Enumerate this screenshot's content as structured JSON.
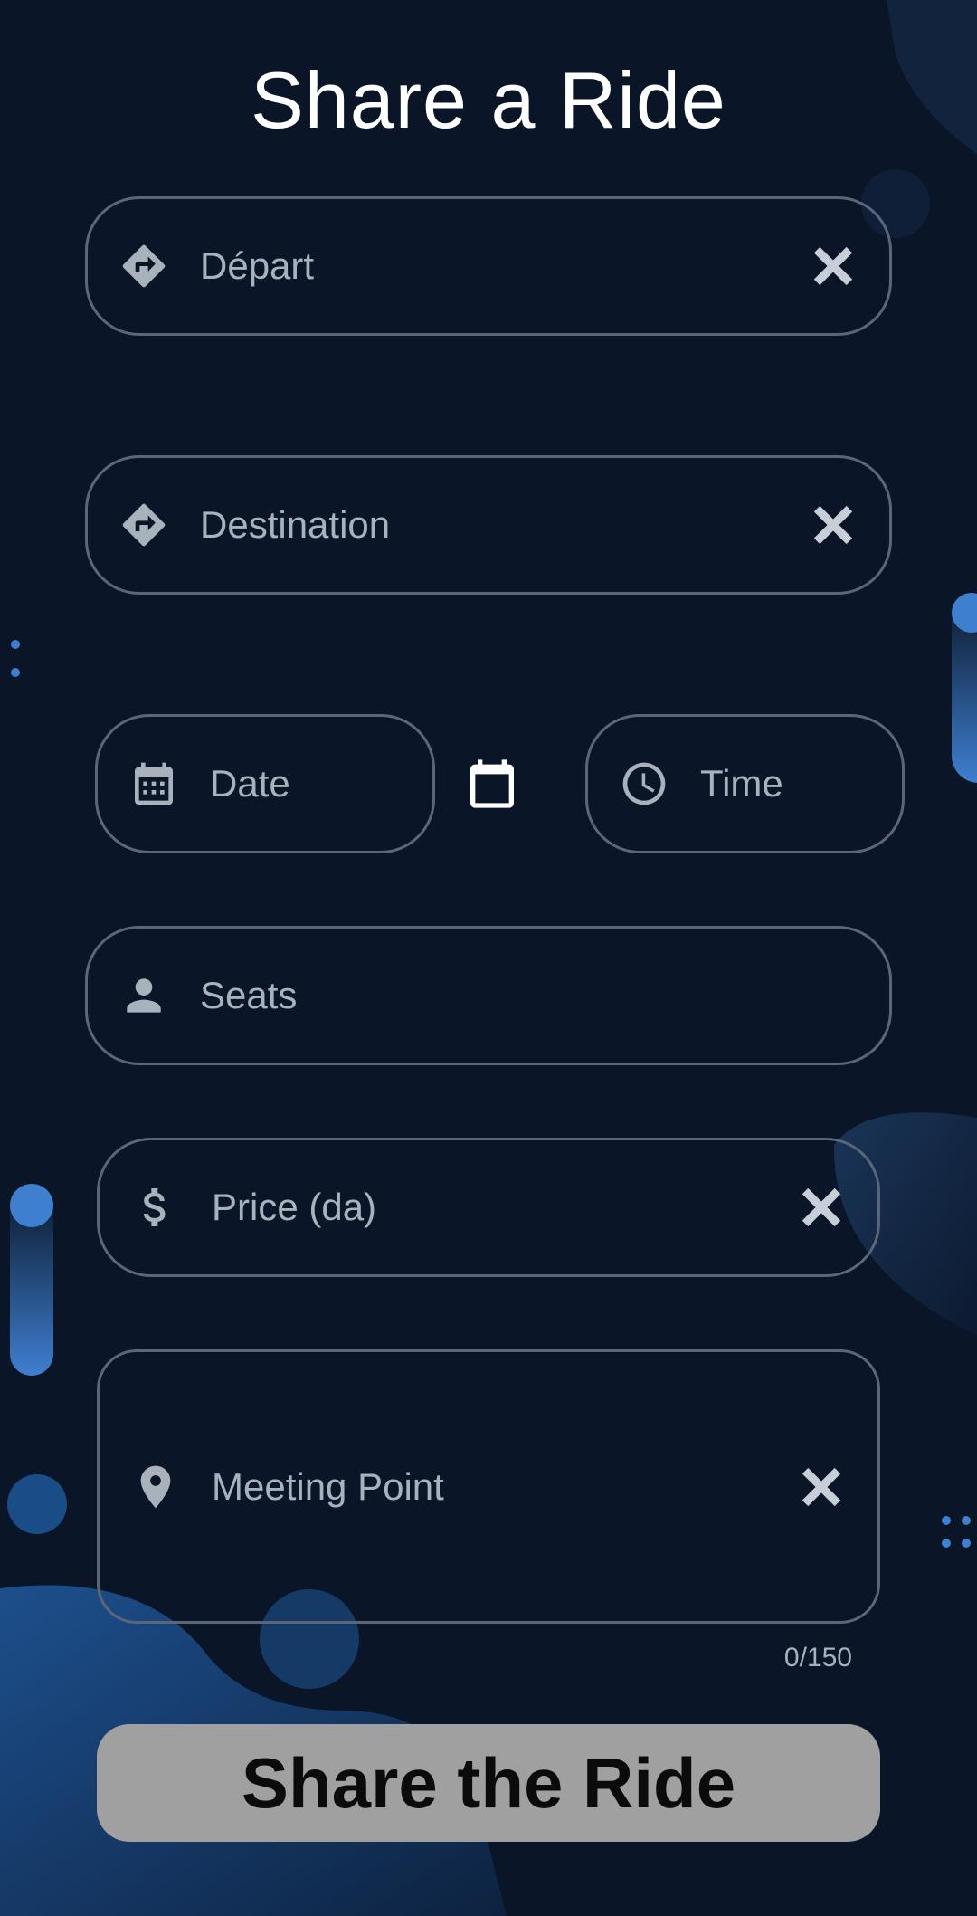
{
  "page": {
    "title": "Share a Ride"
  },
  "colors": {
    "background": "#0a1628",
    "field_border": "#5b6677",
    "placeholder": "#a9b1bd",
    "accent": "#3f7fd0",
    "button_bg": "#a0a0a0",
    "button_text": "#0b0b0b"
  },
  "form": {
    "depart": {
      "label": "Départ",
      "icon": "directions-icon",
      "clear_icon": "close-icon"
    },
    "destination": {
      "label": "Destination",
      "icon": "directions-icon",
      "clear_icon": "close-icon"
    },
    "date": {
      "label": "Date",
      "icon": "calendar-icon"
    },
    "date_picker": {
      "icon": "calendar-icon"
    },
    "time": {
      "label": "Time",
      "icon": "clock-icon"
    },
    "seats": {
      "label": "Seats",
      "icon": "person-icon"
    },
    "price": {
      "label": "Price (da)",
      "icon": "dollar-icon",
      "clear_icon": "close-icon"
    },
    "meeting_point": {
      "label": "Meeting Point",
      "icon": "location-pin-icon",
      "clear_icon": "close-icon",
      "counter": "0/150"
    }
  },
  "submit": {
    "label": "Share the Ride"
  }
}
